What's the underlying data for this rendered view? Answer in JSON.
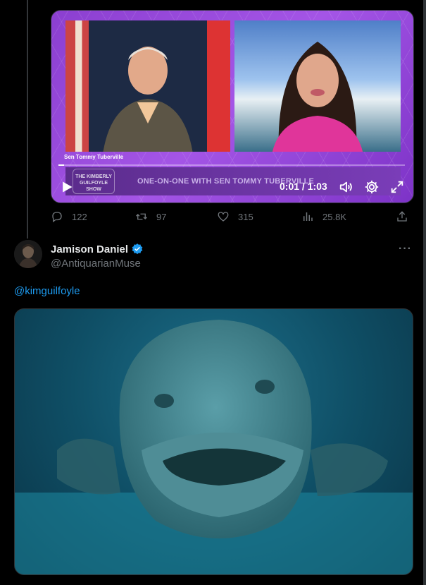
{
  "video": {
    "caption": "Sen Tommy Tuberville",
    "show_logo": "THE KIMBERLY GUILFOYLE SHOW",
    "lower_third": "ONE-ON-ONE WITH SEN TOMMY TUBERVILLE",
    "time": "0:01 / 1:03",
    "progress": 0.016
  },
  "tweet_actions": {
    "replies": "122",
    "retweets": "97",
    "likes": "315",
    "views": "25.8K"
  },
  "reply": {
    "display_name": "Jamison Daniel",
    "handle": "@AntiquarianMuse",
    "more": "···",
    "mention": "@kimguilfoyle"
  },
  "icons": [
    "play-icon",
    "volume-icon",
    "settings-icon",
    "fullscreen-icon",
    "reply-icon",
    "retweet-icon",
    "like-icon",
    "views-icon",
    "share-icon",
    "verified-icon",
    "more-icon"
  ],
  "colors": {
    "accent": "#1d9bf0",
    "muted": "#71767b",
    "video_purple": "#a455e6"
  }
}
